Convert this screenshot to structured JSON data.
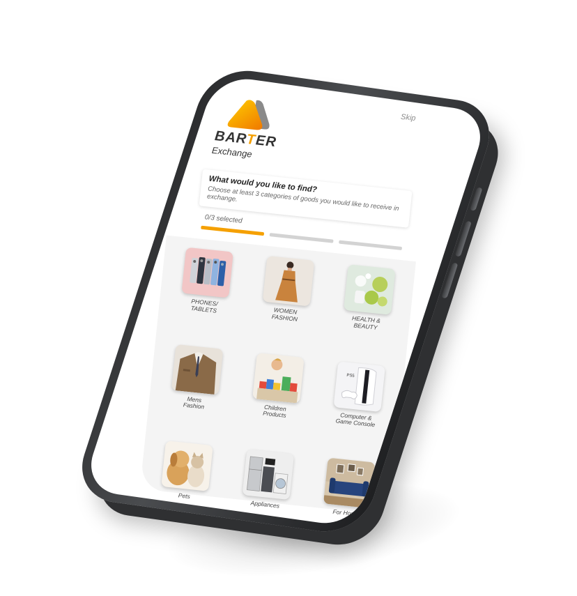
{
  "app": {
    "brand_prefix": "BAR",
    "brand_accent": "T",
    "brand_suffix": "ER",
    "brand_sub": "Exchange",
    "skip_label": "Skip"
  },
  "prompt": {
    "title": "What would you like to find?",
    "description": "Choose at least 3 categories of goods you would like to receive in exchange."
  },
  "progress": {
    "label": "0/3 selected",
    "selected": 0,
    "required": 3
  },
  "categories": [
    {
      "label": "PHONES/\nTABLETS",
      "icon": "phones-tablets-image"
    },
    {
      "label": "WOMEN\nFASHION",
      "icon": "women-fashion-image"
    },
    {
      "label": "HEALTH &\nBEAUTY",
      "icon": "health-beauty-image"
    },
    {
      "label": "Mens\nFashion",
      "icon": "mens-fashion-image"
    },
    {
      "label": "Children\nProducts",
      "icon": "children-products-image"
    },
    {
      "label": "Computer &\nGame Console",
      "icon": "game-console-image"
    },
    {
      "label": "Pets",
      "icon": "pets-image"
    },
    {
      "label": "Appliances",
      "icon": "appliances-image"
    },
    {
      "label": "For Home",
      "icon": "for-home-image"
    }
  ],
  "colors": {
    "accent": "#f5a000",
    "inactive_bar": "#d3d3d3",
    "phone_frame": "#2a2b2d"
  }
}
